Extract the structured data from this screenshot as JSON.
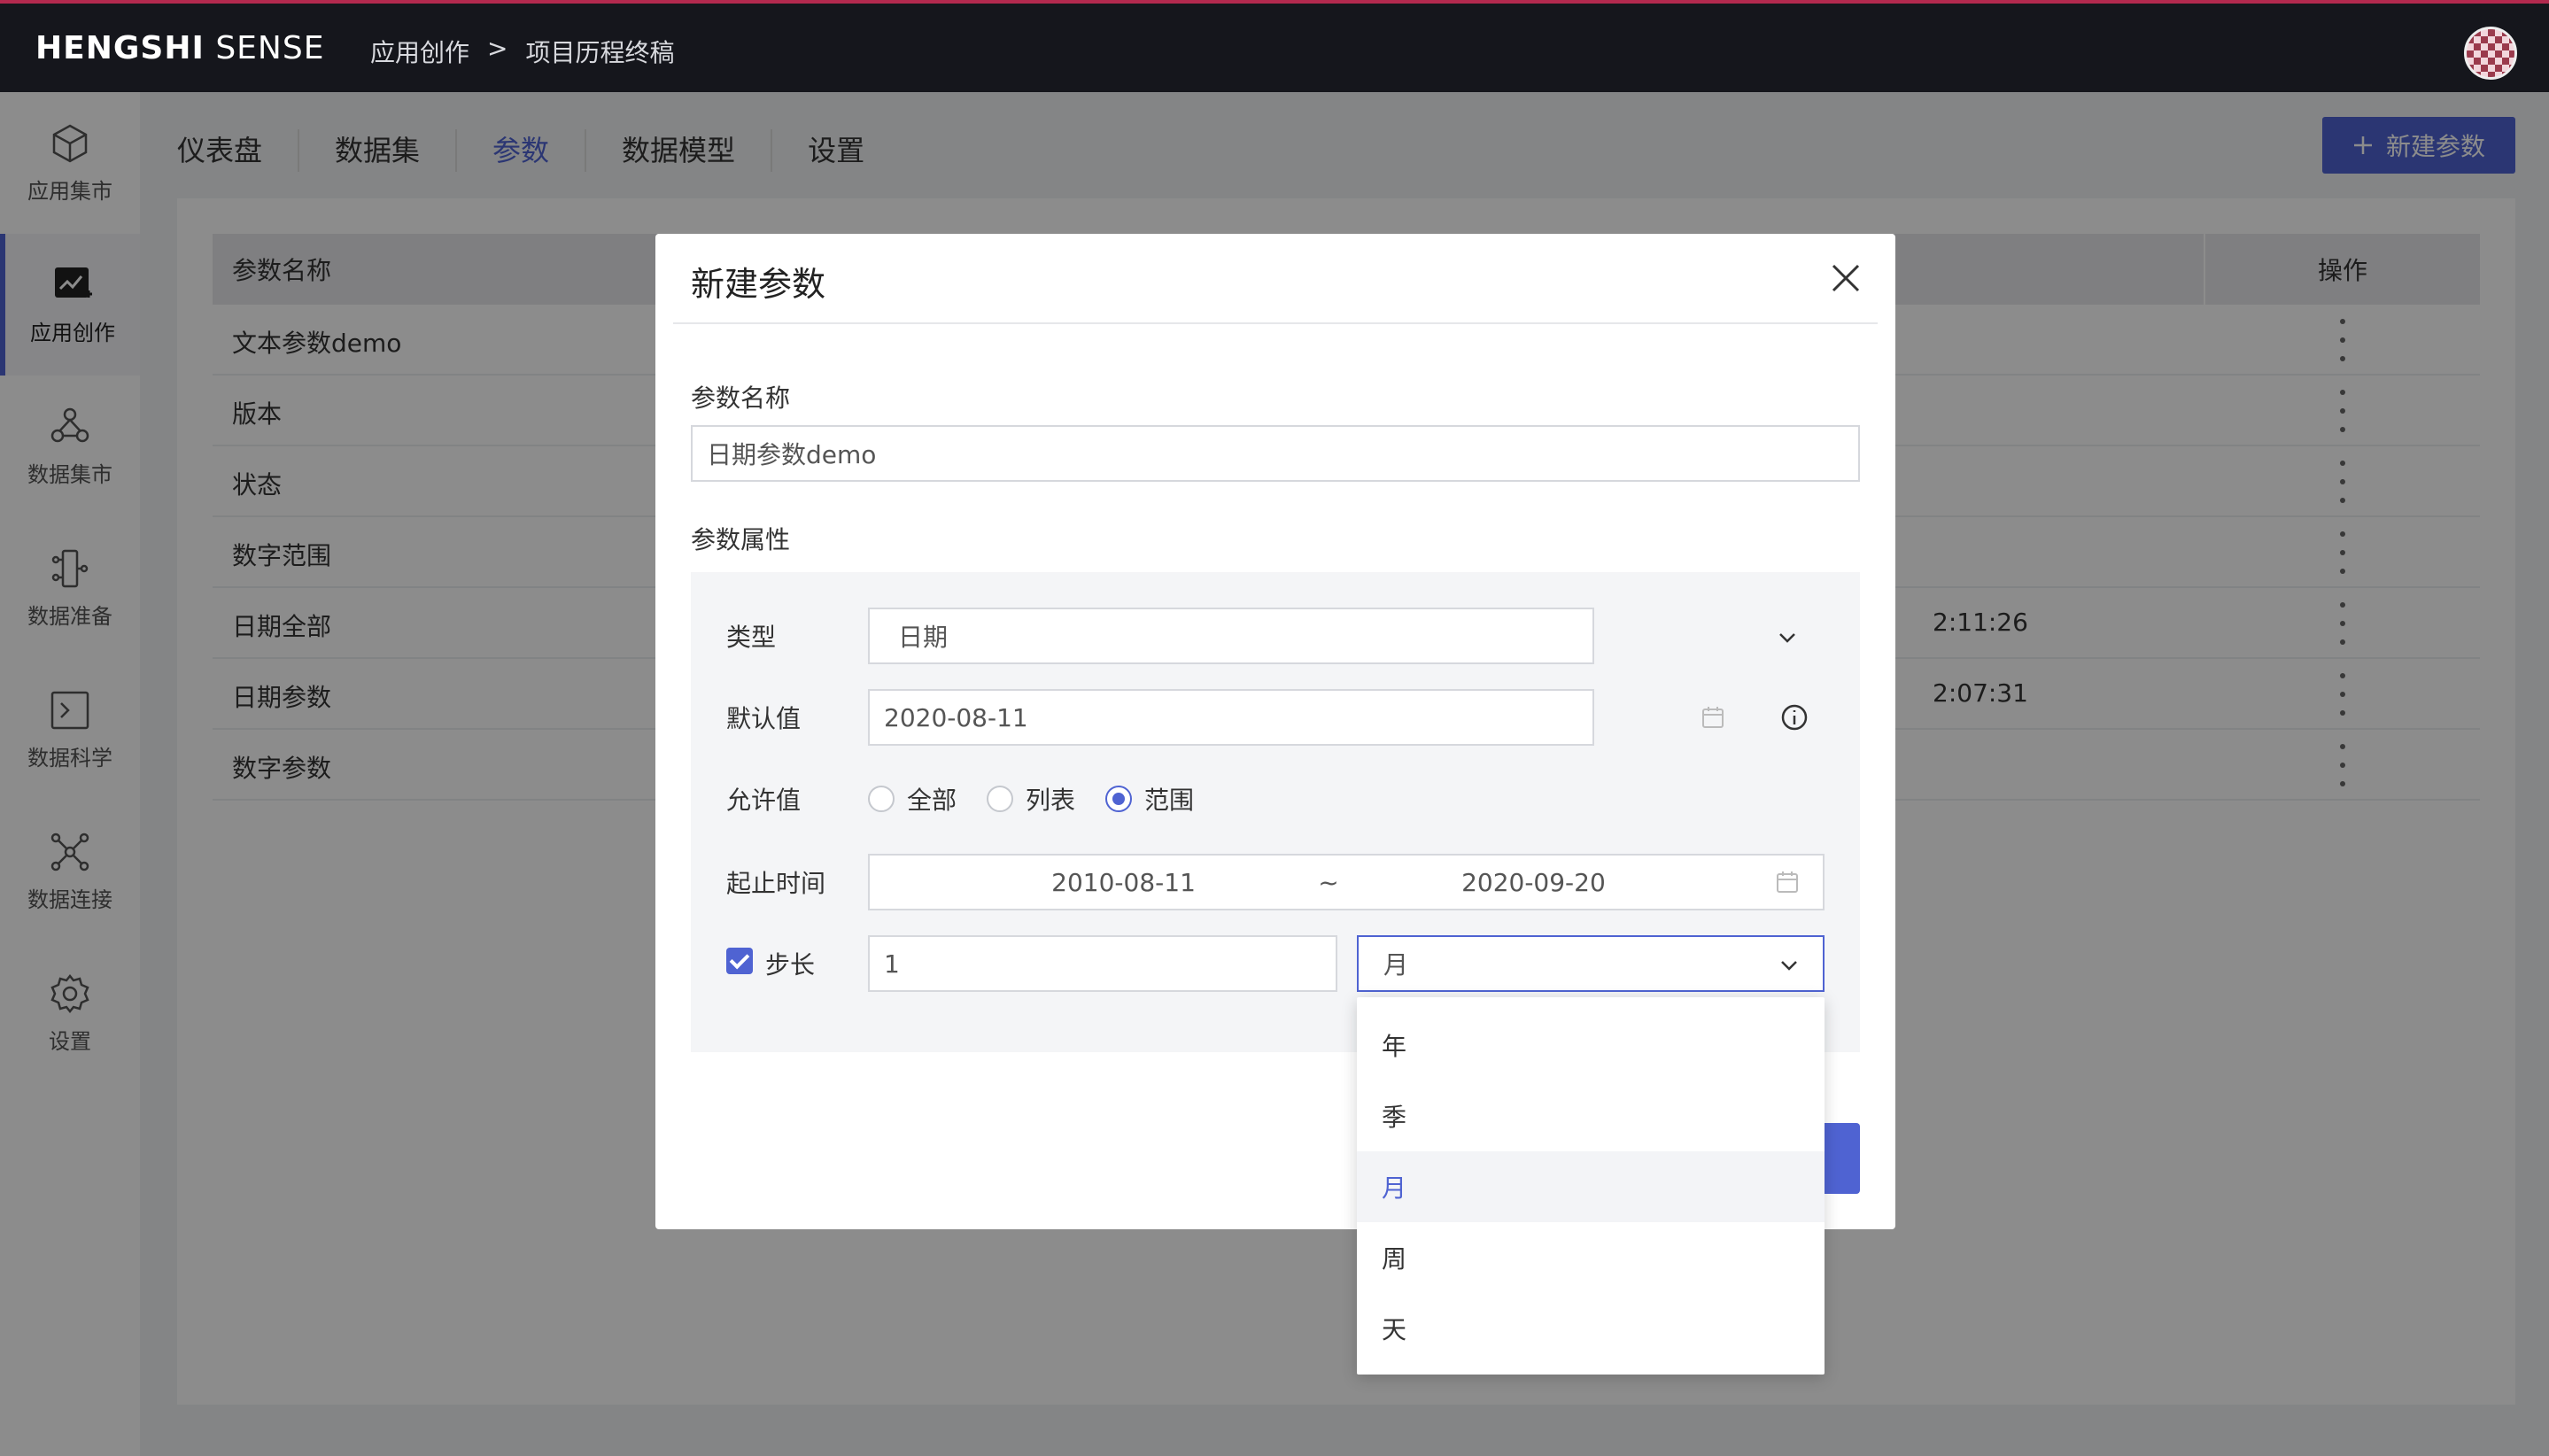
{
  "header": {
    "logo_bold": "HENGSHI",
    "logo_light": "SENSE",
    "breadcrumb": [
      "应用创作",
      ">",
      "项目历程终稿"
    ]
  },
  "sidebar": {
    "items": [
      {
        "label": "应用集市",
        "icon": "cube-icon"
      },
      {
        "label": "应用创作",
        "icon": "chart-edit-icon",
        "active": true
      },
      {
        "label": "数据集市",
        "icon": "dataset-market-icon"
      },
      {
        "label": "数据准备",
        "icon": "data-prep-icon"
      },
      {
        "label": "数据科学",
        "icon": "terminal-icon"
      },
      {
        "label": "数据连接",
        "icon": "network-icon"
      },
      {
        "label": "设置",
        "icon": "gear-icon"
      }
    ]
  },
  "tabs": [
    {
      "label": "仪表盘"
    },
    {
      "label": "数据集"
    },
    {
      "label": "参数",
      "active": true
    },
    {
      "label": "数据模型"
    },
    {
      "label": "设置"
    }
  ],
  "new_param_button": "新建参数",
  "table": {
    "headers": {
      "name": "参数名称",
      "op": "操作"
    },
    "rows": [
      {
        "name": "文本参数demo",
        "time": ""
      },
      {
        "name": "版本",
        "time": ""
      },
      {
        "name": "状态",
        "time": ""
      },
      {
        "name": "数字范围",
        "time": ""
      },
      {
        "name": "日期全部",
        "time": "2:11:26"
      },
      {
        "name": "日期参数",
        "time": "2:07:31"
      },
      {
        "name": "数字参数",
        "time": ""
      }
    ]
  },
  "modal": {
    "title": "新建参数",
    "name_label": "参数名称",
    "name_value": "日期参数demo",
    "attr_label": "参数属性",
    "type_label": "类型",
    "type_value": "日期",
    "default_label": "默认值",
    "default_value": "2020-08-11",
    "allowed_label": "允许值",
    "allowed_options": [
      "全部",
      "列表",
      "范围"
    ],
    "allowed_selected": "范围",
    "range_label": "起止时间",
    "range_start": "2010-08-11",
    "range_sep": "~",
    "range_end": "2020-09-20",
    "step_label": "步长",
    "step_checked": true,
    "step_value": "1",
    "step_unit": "月"
  },
  "dropdown": {
    "options": [
      "年",
      "季",
      "月",
      "周",
      "天"
    ],
    "selected": "月"
  },
  "colors": {
    "accent": "#4f63d2",
    "topbar": "#15161c",
    "top_stripe": "#b3294e"
  }
}
